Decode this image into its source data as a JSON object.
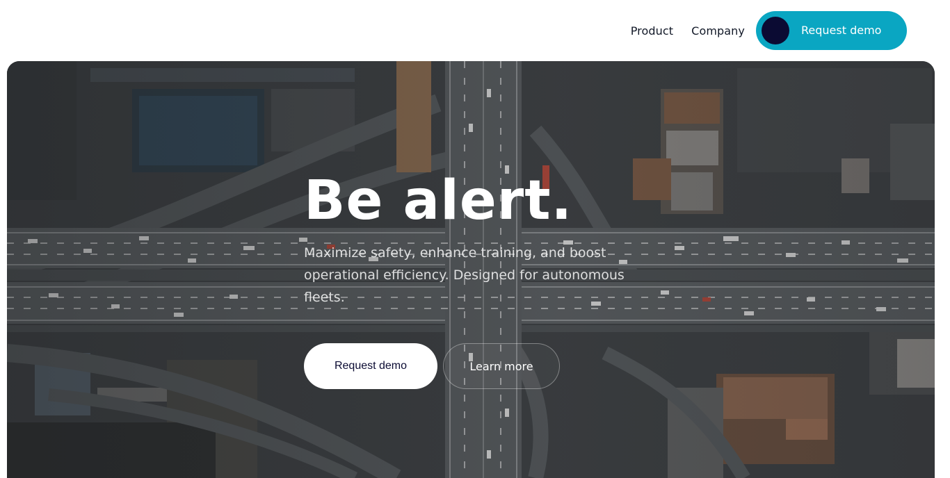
{
  "nav": {
    "links": [
      "Product",
      "Company"
    ],
    "cta_label": "Request demo"
  },
  "hero": {
    "title": "Be alert.",
    "subtitle": "Maximize safety, enhance training, and boost operational efficiency. Designed for autonomous fleets.",
    "primary_button": "Request demo",
    "secondary_button": "Learn more",
    "background": "aerial-highway-interchange-photo"
  },
  "colors": {
    "accent": "#0aa6c2",
    "navy": "#0b0b33",
    "white": "#ffffff"
  }
}
